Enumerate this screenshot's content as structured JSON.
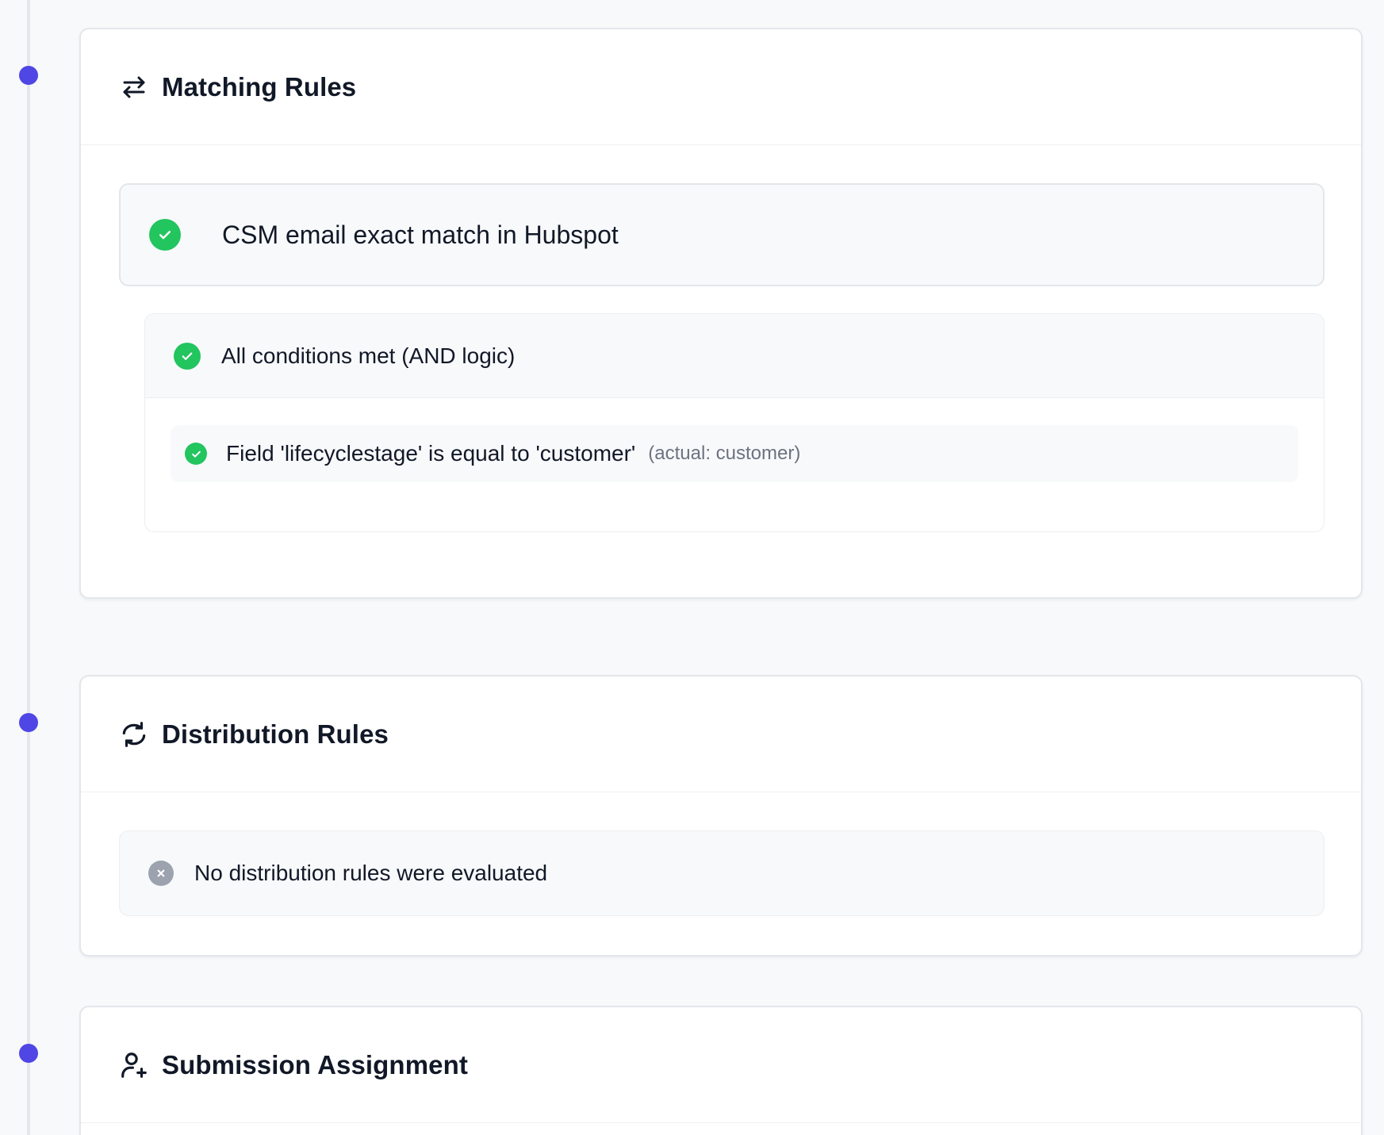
{
  "sections": {
    "matching": {
      "title": "Matching Rules",
      "rule": {
        "label": "CSM email exact match in Hubspot",
        "status": "passed"
      },
      "condition_group": {
        "label": "All conditions met (AND logic)",
        "status": "passed",
        "conditions": [
          {
            "label": "Field 'lifecyclestage' is equal to 'customer'",
            "actual": "(actual: customer)",
            "status": "passed"
          }
        ]
      }
    },
    "distribution": {
      "title": "Distribution Rules",
      "empty_message": "No distribution rules were evaluated",
      "status": "not-evaluated"
    },
    "assignment": {
      "title": "Submission Assignment"
    }
  },
  "colors": {
    "timeline_dot": "#4f46e5",
    "success": "#22c55e",
    "neutral": "#9ca3af"
  }
}
